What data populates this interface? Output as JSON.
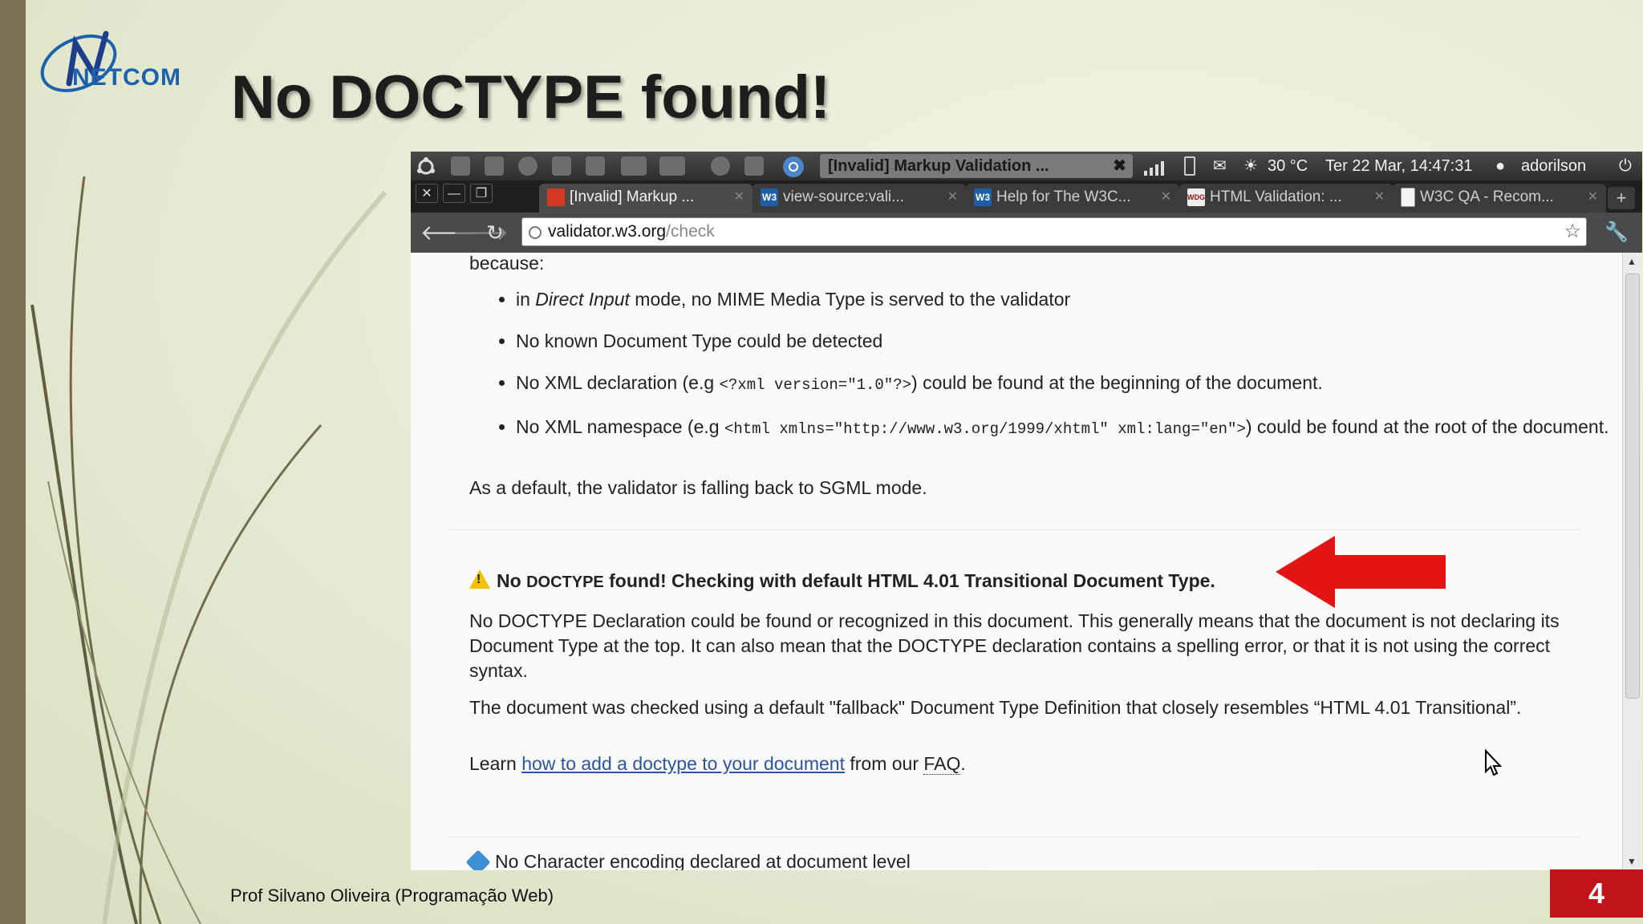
{
  "slide": {
    "title": "No DOCTYPE found!",
    "logo_text": "NETCOM",
    "footer": "Prof Silvano Oliveira (Programação Web)",
    "page_number": "4",
    "accent_color": "#c0141a"
  },
  "desktop_panel": {
    "window_title": "[Invalid] Markup Validation ...",
    "weather": "30 °C",
    "datetime": "Ter 22 Mar, 14:47:31",
    "user": "adorilson",
    "icons": [
      "ubuntu-logo-icon",
      "files-icon",
      "disk-icon",
      "globe-icon",
      "doc-icon",
      "doc-icon",
      "list-icon",
      "keyboard-icon",
      "gear-icon",
      "wrench-icon",
      "chrome-icon",
      "signal-icon",
      "battery-icon",
      "mail-icon",
      "weather-icon",
      "user-icon",
      "power-icon"
    ]
  },
  "browser": {
    "tabs": [
      {
        "label": "[Invalid] Markup ...",
        "favicon": "red-square",
        "active": true
      },
      {
        "label": "view-source:vali...",
        "favicon": "W3"
      },
      {
        "label": "Help for The W3C...",
        "favicon": "W3"
      },
      {
        "label": "HTML Validation: ...",
        "favicon": "WDG"
      },
      {
        "label": "W3C QA - Recom...",
        "favicon": "page"
      }
    ],
    "url_host": "validator.w3.org",
    "url_path": "/check"
  },
  "page": {
    "cut_text": "because:",
    "bullets": {
      "b1_pre": "in ",
      "b1_em": "Direct Input",
      "b1_post": " mode, no MIME Media Type is served to the validator",
      "b2": "No known Document Type could be detected",
      "b3_pre": "No XML declaration (e.g ",
      "b3_code": "<?xml version=\"1.0\"?>",
      "b3_post": ") could be found at the beginning of the document.",
      "b4_pre": "No XML namespace (e.g ",
      "b4_code": "<html xmlns=\"http://www.w3.org/1999/xhtml\" xml:lang=\"en\">",
      "b4_post": ") could be found at the root of the document."
    },
    "default_text": "As a default, the validator is falling back to SGML mode.",
    "warning": {
      "head_pre": "No ",
      "head_sc": "DOCTYPE",
      "head_post": " found! Checking with default HTML 4.01 Transitional Document Type.",
      "p1": "No DOCTYPE Declaration could be found or recognized in this document. This generally means that the document is not declaring its Document Type at the top. It can also mean that the DOCTYPE declaration contains a spelling error, or that it is not using the correct syntax.",
      "p2": "The document was checked using a default \"fallback\" Document Type Definition that closely resembles “HTML 4.01 Transitional”.",
      "learn_pre": "Learn ",
      "learn_link": "how to add a doctype to your document",
      "learn_mid": " from our ",
      "learn_faq": "FAQ",
      "learn_post": "."
    },
    "next_message": "No Character encoding declared at document level"
  }
}
